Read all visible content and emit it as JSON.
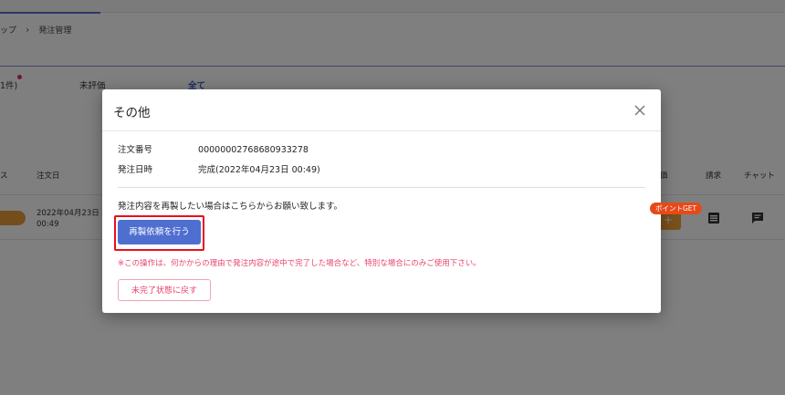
{
  "breadcrumb": {
    "parent": "ップ",
    "separator": "›",
    "current": "発注管理"
  },
  "tabs": [
    {
      "label": "1件)",
      "has_notification_dot": true
    },
    {
      "label": "未評価"
    },
    {
      "label": "全て",
      "active": true
    }
  ],
  "table": {
    "headers": {
      "status_fragment": "ス",
      "order_date": "注文日",
      "rating_fragment": "価",
      "billing": "請求",
      "chat": "チャット"
    },
    "row": {
      "order_date_line1": "2022年04月23日",
      "order_date_line2": "00:49",
      "point_badge": "ポイントGET",
      "plus_label": "+"
    }
  },
  "modal": {
    "title": "その他",
    "close_icon": "close-icon",
    "order_number_label": "注文番号",
    "order_number_value": "00000002768680933278",
    "order_datetime_label": "発注日時",
    "order_datetime_value": "完成(2022年04月23日 00:49)",
    "reprint_description": "発注内容を再製したい場合はこちらからお願い致します。",
    "reprint_button_label": "再製依頼を行う",
    "warning_text": "※この操作は、何かからの理由で発注内容が途中で完了した場合など、特別な場合にのみご使用下さい。",
    "revert_button_label": "未完了状態に戻す"
  },
  "colors": {
    "primary": "#4f6fd0",
    "warning": "#e8456b",
    "highlight": "#e8101a",
    "overlay": "rgba(0,0,0,0.5)",
    "badge": "#e64a19",
    "accent_orange": "#f0a23b"
  }
}
